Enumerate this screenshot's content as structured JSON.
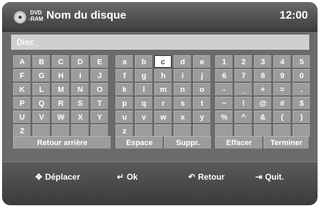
{
  "header": {
    "title": "Nom du disque",
    "dvd_line1": "DVD",
    "dvd_line2": "-RAM",
    "clock": "12:00"
  },
  "input": {
    "value": "Disc_"
  },
  "keyboard": {
    "selected": "c",
    "groups": [
      {
        "rows": [
          [
            "A",
            "B",
            "C",
            "D",
            "E"
          ],
          [
            "F",
            "G",
            "H",
            "I",
            "J"
          ],
          [
            "K",
            "L",
            "M",
            "N",
            "O"
          ],
          [
            "P",
            "Q",
            "R",
            "S",
            "T"
          ],
          [
            "U",
            "V",
            "W",
            "X",
            "Y"
          ],
          [
            "Z",
            "",
            "",
            "",
            ""
          ]
        ]
      },
      {
        "rows": [
          [
            "a",
            "b",
            "c",
            "d",
            "e"
          ],
          [
            "f",
            "g",
            "h",
            "i",
            "j"
          ],
          [
            "k",
            "l",
            "m",
            "n",
            "o"
          ],
          [
            "p",
            "q",
            "r",
            "s",
            "t"
          ],
          [
            "u",
            "v",
            "w",
            "x",
            "y"
          ],
          [
            "z",
            "",
            "",
            "",
            ""
          ]
        ]
      },
      {
        "rows": [
          [
            "1",
            "2",
            "3",
            "4",
            "5"
          ],
          [
            "6",
            "7",
            "8",
            "9",
            "0"
          ],
          [
            "-",
            "_",
            "+",
            "=",
            "."
          ],
          [
            "~",
            "!",
            "@",
            "#",
            "$"
          ],
          [
            "%",
            "^",
            "&",
            "(",
            ")"
          ],
          [
            "",
            "",
            "",
            "",
            ""
          ]
        ]
      }
    ]
  },
  "actions": {
    "back": "Retour arrière",
    "space": "Espace",
    "delete": "Suppr.",
    "clear": "Effacer",
    "finish": "Terminer"
  },
  "footer": {
    "move": "Déplacer",
    "ok": "Ok",
    "return": "Retour",
    "quit": "Quit."
  },
  "colors": {
    "key": "#9c9c9c",
    "selected_key": "#ffffff",
    "background": "#6b6b6b"
  }
}
